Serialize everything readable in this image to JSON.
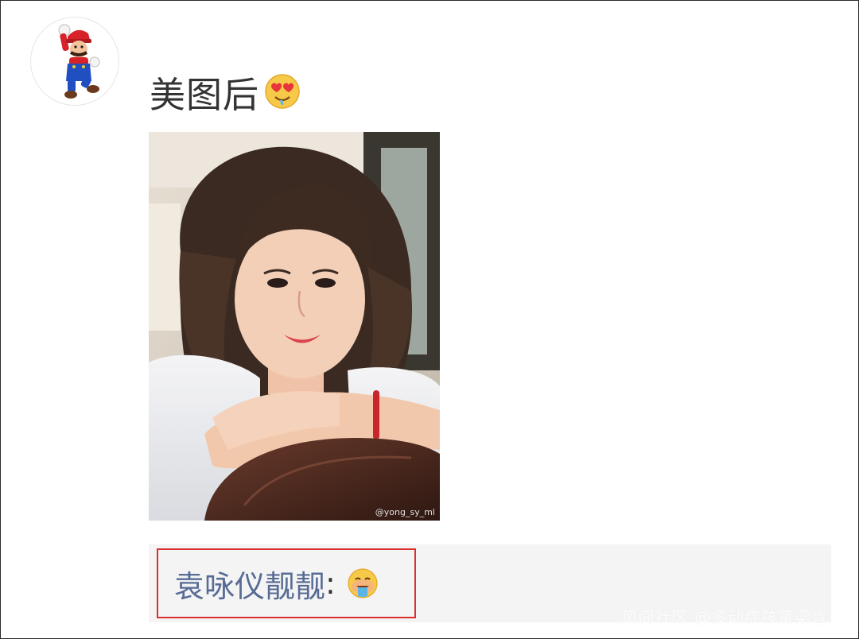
{
  "post": {
    "text": "美图后",
    "text_emoji": "heart-eyes-drooling-emoji",
    "avatar_icon": "mario-avatar-icon"
  },
  "photo": {
    "watermark": "@yong_sy_ml"
  },
  "comment": {
    "author": "袁咏仪靓靓",
    "separator": ":",
    "emoji": "drooling-face-emoji"
  },
  "watermark": {
    "text": "风闻社区 @多动症孩童梁言"
  },
  "colors": {
    "author_link": "#576b95",
    "highlight_border": "#d9302f",
    "comment_bg": "#f4f4f4",
    "text": "#333333"
  }
}
